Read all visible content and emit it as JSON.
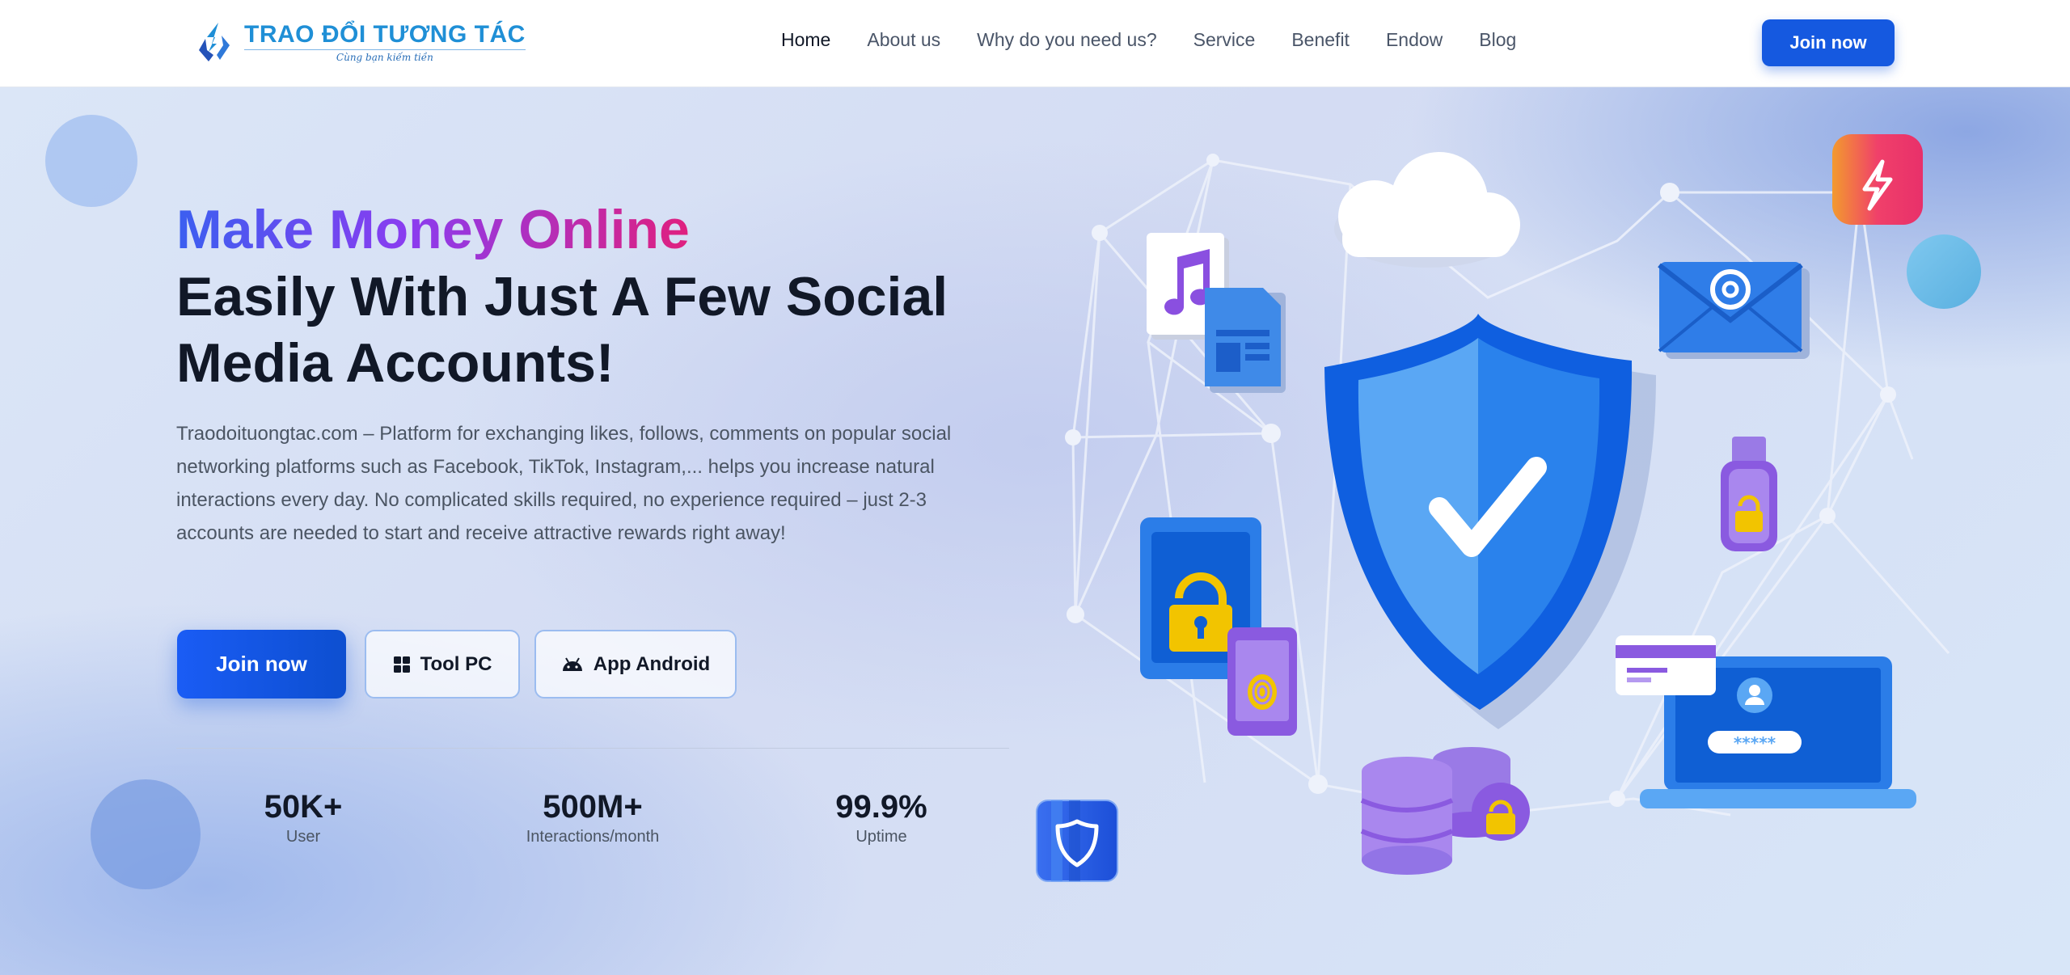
{
  "header": {
    "logo_title": "TRAO ĐỔI TƯƠNG TÁC",
    "logo_subtitle": "Cùng bạn kiếm tiền",
    "nav": [
      {
        "label": "Home",
        "active": true
      },
      {
        "label": "About us"
      },
      {
        "label": "Why do you need us?"
      },
      {
        "label": "Service"
      },
      {
        "label": "Benefit"
      },
      {
        "label": "Endow"
      },
      {
        "label": "Blog"
      }
    ],
    "join_label": "Join now"
  },
  "hero": {
    "headline_gradient": "Make Money Online",
    "headline_rest": "Easily With Just A Few Social Media Accounts!",
    "description": "Traodoituongtac.com – Platform for exchanging likes, follows, comments on popular social networking platforms such as Facebook, TikTok, Instagram,... helps you increase natural interactions every day. No complicated skills required, no experience required – just 2-3 accounts are needed to start and receive attractive rewards right away!",
    "join_label": "Join now",
    "tool_pc_label": "Tool PC",
    "app_android_label": "App Android",
    "stats": [
      {
        "value": "50K+",
        "label": "User"
      },
      {
        "value": "500M+",
        "label": "Interactions/month"
      },
      {
        "value": "99.9%",
        "label": "Uptime"
      }
    ]
  },
  "colors": {
    "primary": "#1559e0",
    "gradient_start": "#3b5ff0",
    "gradient_mid": "#8a3cf0",
    "gradient_end": "#e0207e",
    "shield": "#1565e8"
  },
  "icons": [
    "windows-icon",
    "android-icon",
    "shield-check-icon",
    "lightning-icon",
    "email-icon",
    "cloud-icon",
    "music-note-icon",
    "lock-icon",
    "fingerprint-icon",
    "usb-lock-icon",
    "database-lock-icon",
    "user-icon",
    "shield-small-icon"
  ]
}
